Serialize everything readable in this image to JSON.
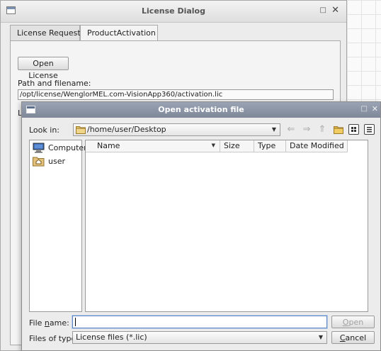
{
  "license_dialog": {
    "title": "License Dialog",
    "tabs": [
      {
        "label": "License Request",
        "active": false
      },
      {
        "label": "ProductActivation",
        "active": true
      }
    ],
    "open_license_label": "Open License",
    "path_label": "Path and filename:",
    "path_value": "/opt/license/WenglorMEL.com-VisionApp360/activation.lic",
    "partial_label": "L"
  },
  "file_dialog": {
    "title": "Open activation file",
    "look_in_label": "Look in:",
    "look_in_value": "/home/user/Desktop",
    "sidebar": [
      {
        "label": "Computer",
        "icon": "computer-icon"
      },
      {
        "label": "user",
        "icon": "home-folder-icon"
      }
    ],
    "columns": [
      "Name",
      "Size",
      "Type",
      "Date Modified"
    ],
    "file_name_label": "File name:",
    "file_name_value": "",
    "files_of_type_label": "Files of type:",
    "files_of_type_value": "License files (*.lic)",
    "open_label": "Open",
    "cancel_label": "Cancel"
  }
}
